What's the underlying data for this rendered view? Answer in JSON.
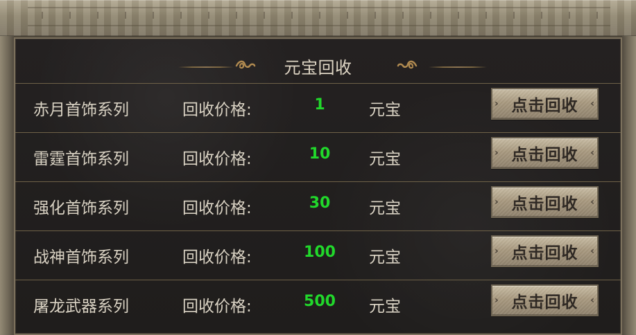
{
  "window": {
    "title": "元宝回收"
  },
  "colors": {
    "accent_green": "#21d82b",
    "panel_text": "#d9d2c3",
    "button_text": "#2f2924",
    "ornament_gold": "#b08a50"
  },
  "rows": [
    {
      "name": "赤月首饰系列",
      "price_label": "回收价格:",
      "price": "1",
      "currency": "元宝",
      "button_label": "点击回收"
    },
    {
      "name": "雷霆首饰系列",
      "price_label": "回收价格:",
      "price": "10",
      "currency": "元宝",
      "button_label": "点击回收"
    },
    {
      "name": "强化首饰系列",
      "price_label": "回收价格:",
      "price": "30",
      "currency": "元宝",
      "button_label": "点击回收"
    },
    {
      "name": "战神首饰系列",
      "price_label": "回收价格:",
      "price": "100",
      "currency": "元宝",
      "button_label": "点击回收"
    },
    {
      "name": "屠龙武器系列",
      "price_label": "回收价格:",
      "price": "500",
      "currency": "元宝",
      "button_label": "点击回收"
    }
  ],
  "ornaments": {
    "left_icon": "ornament-scroll-icon",
    "right_icon": "ornament-scroll-icon"
  }
}
